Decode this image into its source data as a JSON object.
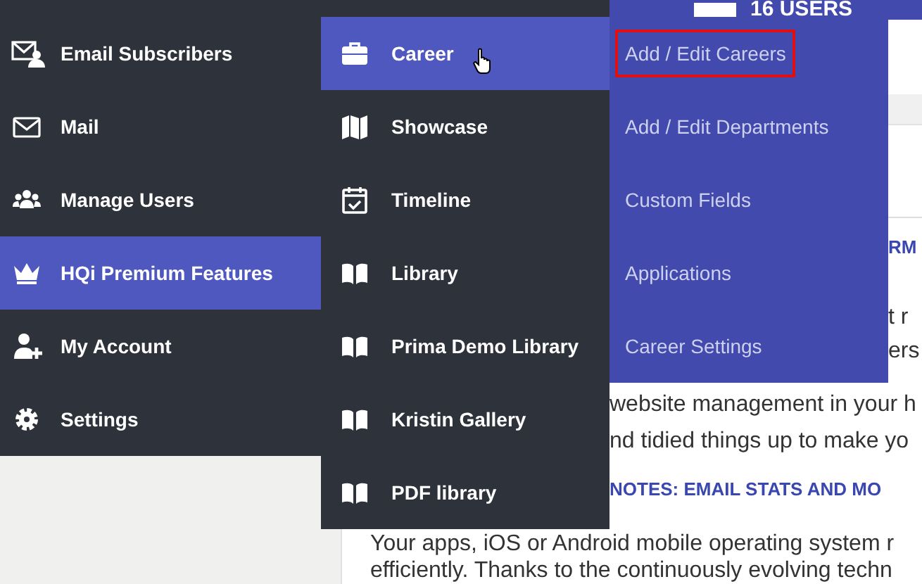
{
  "header": {
    "users": "16 USERS"
  },
  "sidebar": {
    "items": [
      {
        "label": "Email Subscribers",
        "selected": false
      },
      {
        "label": "Mail",
        "selected": false
      },
      {
        "label": "Manage Users",
        "selected": false
      },
      {
        "label": "HQi Premium Features",
        "selected": true
      },
      {
        "label": "My Account",
        "selected": false
      },
      {
        "label": "Settings",
        "selected": false
      }
    ]
  },
  "submenu": {
    "items": [
      {
        "label": "Career",
        "selected": true
      },
      {
        "label": "Showcase",
        "selected": false
      },
      {
        "label": "Timeline",
        "selected": false
      },
      {
        "label": "Library",
        "selected": false
      },
      {
        "label": "Prima Demo Library",
        "selected": false
      },
      {
        "label": "Kristin Gallery",
        "selected": false
      },
      {
        "label": "PDF library",
        "selected": false
      }
    ]
  },
  "flyout": {
    "items": [
      {
        "label": "Add / Edit Careers",
        "highlighted": true
      },
      {
        "label": "Add / Edit Departments",
        "highlighted": false
      },
      {
        "label": "Custom Fields",
        "highlighted": false
      },
      {
        "label": "Applications",
        "highlighted": false
      },
      {
        "label": "Career Settings",
        "highlighted": false
      }
    ]
  },
  "article": {
    "lines": [
      {
        "kind": "heading",
        "text": "RM"
      },
      {
        "kind": "text",
        "text": "t r"
      },
      {
        "kind": "text",
        "text": "ers"
      },
      {
        "kind": "text",
        "text": "website management in your h"
      },
      {
        "kind": "text",
        "text": "nd tidied things up to make yo"
      },
      {
        "kind": "heading",
        "text": "NOTES: EMAIL STATS AND MO"
      },
      {
        "kind": "text",
        "text": "Your apps, iOS or Android mobile operating system r"
      },
      {
        "kind": "text",
        "text": "efficiently. Thanks to the continuously evolving techn"
      }
    ]
  }
}
